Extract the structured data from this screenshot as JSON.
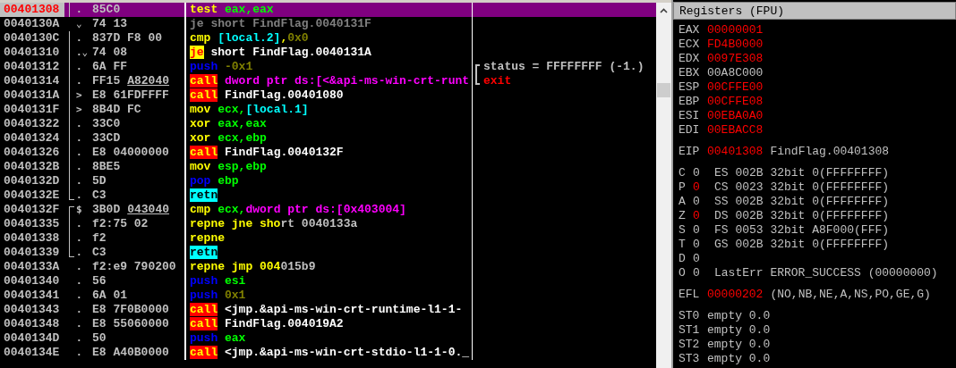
{
  "disassembly": {
    "rows": [
      {
        "address": "00401308",
        "selected": true,
        "marker": ".",
        "bracket": true,
        "bytes": "85C0",
        "tokens": [
          {
            "text": "test",
            "kind": "op"
          },
          {
            "text": " eax,eax",
            "kind": "reg"
          }
        ]
      },
      {
        "address": "0040130A",
        "selected": false,
        "marker": "⌄",
        "bracket": false,
        "bytes": "74 13",
        "tokens": [
          {
            "text": "je short FindFlag.0040131F",
            "kind": "dim"
          }
        ]
      },
      {
        "address": "0040130C",
        "selected": false,
        "marker": ".",
        "bracket": true,
        "bytes": "837D F8 00",
        "tokens": [
          {
            "text": "cmp",
            "kind": "op"
          },
          {
            "text": " [local.2]",
            "kind": "local"
          },
          {
            "text": ",",
            "kind": "op"
          },
          {
            "text": "0x0",
            "kind": "imm"
          }
        ]
      },
      {
        "address": "00401310",
        "selected": false,
        "marker": ".⌄",
        "bracket": true,
        "bytes": "74 08",
        "tokens": [
          {
            "text": "je",
            "kind": "jcc"
          },
          {
            "text": " short FindFlag.0040131A",
            "kind": "label"
          }
        ]
      },
      {
        "address": "00401312",
        "selected": false,
        "marker": ".",
        "bracket": true,
        "bytes": "6A FF",
        "tokens": [
          {
            "text": "push",
            "kind": "stack"
          },
          {
            "text": " -0x1",
            "kind": "imm"
          }
        ],
        "comment": {
          "text": "status = FFFFFFFF (-1.)",
          "kind": "arg"
        }
      },
      {
        "address": "00401314",
        "selected": false,
        "marker": ".",
        "bracket": true,
        "bytes": "FF15",
        "fixup": "A82040",
        "tokens": [
          {
            "text": "call",
            "kind": "call"
          },
          {
            "text": " dword ptr ds:[<&api-ms-win-crt-runt",
            "kind": "mem"
          }
        ],
        "comment": {
          "text": "exit",
          "kind": "api"
        }
      },
      {
        "address": "0040131A",
        "selected": false,
        "marker": ">",
        "bracket": true,
        "bytes": "E8 61FDFFFF",
        "tokens": [
          {
            "text": "call",
            "kind": "call"
          },
          {
            "text": " FindFlag.00401080",
            "kind": "label"
          }
        ]
      },
      {
        "address": "0040131F",
        "selected": false,
        "marker": ">",
        "bracket": true,
        "bytes": "8B4D FC",
        "tokens": [
          {
            "text": "mov",
            "kind": "op"
          },
          {
            "text": " ecx,",
            "kind": "reg"
          },
          {
            "text": "[local.1]",
            "kind": "local"
          }
        ]
      },
      {
        "address": "00401322",
        "selected": false,
        "marker": ".",
        "bracket": true,
        "bytes": "33C0",
        "tokens": [
          {
            "text": "xor",
            "kind": "op"
          },
          {
            "text": " eax,eax",
            "kind": "reg"
          }
        ]
      },
      {
        "address": "00401324",
        "selected": false,
        "marker": ".",
        "bracket": true,
        "bytes": "33CD",
        "tokens": [
          {
            "text": "xor",
            "kind": "op"
          },
          {
            "text": " ecx,ebp",
            "kind": "reg"
          }
        ]
      },
      {
        "address": "00401326",
        "selected": false,
        "marker": ".",
        "bracket": true,
        "bytes": "E8 04000000",
        "tokens": [
          {
            "text": "call",
            "kind": "call"
          },
          {
            "text": " FindFlag.0040132F",
            "kind": "label"
          }
        ]
      },
      {
        "address": "0040132B",
        "selected": false,
        "marker": ".",
        "bracket": true,
        "bytes": "8BE5",
        "tokens": [
          {
            "text": "mov",
            "kind": "op"
          },
          {
            "text": " esp,ebp",
            "kind": "reg"
          }
        ]
      },
      {
        "address": "0040132D",
        "selected": false,
        "marker": ".",
        "bracket": true,
        "bytes": "5D",
        "tokens": [
          {
            "text": "pop",
            "kind": "stack"
          },
          {
            "text": " ebp",
            "kind": "reg"
          }
        ]
      },
      {
        "address": "0040132E",
        "selected": false,
        "marker": ".",
        "bracket": true,
        "bracket_bottom": true,
        "bytes": "C3",
        "tokens": [
          {
            "text": "retn",
            "kind": "ret"
          }
        ]
      },
      {
        "address": "0040132F",
        "selected": false,
        "marker": "$",
        "bracket": true,
        "bracket_top": true,
        "bytes": "3B0D",
        "fixup": "043040",
        "tokens": [
          {
            "text": "cmp",
            "kind": "op"
          },
          {
            "text": " ecx,",
            "kind": "reg"
          },
          {
            "text": "dword ptr ds:[0x403004]",
            "kind": "mem"
          }
        ]
      },
      {
        "address": "00401335",
        "selected": false,
        "marker": ".",
        "bracket": true,
        "bytes": "f2:75 02",
        "tokens": [
          {
            "text": "repne jne sho",
            "kind": "op"
          },
          {
            "text": "rt 0040133a",
            "kind": "plain"
          }
        ]
      },
      {
        "address": "00401338",
        "selected": false,
        "marker": ".",
        "bracket": true,
        "bytes": "f2",
        "tokens": [
          {
            "text": "repne",
            "kind": "op"
          }
        ]
      },
      {
        "address": "00401339",
        "selected": false,
        "marker": ".",
        "bracket": true,
        "bracket_bottom": true,
        "bytes": "C3",
        "tokens": [
          {
            "text": "retn",
            "kind": "ret"
          }
        ]
      },
      {
        "address": "0040133A",
        "selected": false,
        "marker": ".",
        "bracket": false,
        "bytes": "f2:e9 790200",
        "tokens": [
          {
            "text": "repne jmp 004",
            "kind": "op"
          },
          {
            "text": "015b9",
            "kind": "plain"
          }
        ]
      },
      {
        "address": "00401340",
        "selected": false,
        "marker": ".",
        "bracket": false,
        "bytes": "56",
        "tokens": [
          {
            "text": "push",
            "kind": "stack"
          },
          {
            "text": " esi",
            "kind": "reg"
          }
        ]
      },
      {
        "address": "00401341",
        "selected": false,
        "marker": ".",
        "bracket": false,
        "bytes": "6A 01",
        "tokens": [
          {
            "text": "push",
            "kind": "stack"
          },
          {
            "text": " 0x1",
            "kind": "imm"
          }
        ]
      },
      {
        "address": "00401343",
        "selected": false,
        "marker": ".",
        "bracket": false,
        "bytes": "E8 7F0B0000",
        "tokens": [
          {
            "text": "call",
            "kind": "call"
          },
          {
            "text": " <jmp.&api-ms-win-crt-runtime-l1-1-",
            "kind": "label"
          }
        ]
      },
      {
        "address": "00401348",
        "selected": false,
        "marker": ".",
        "bracket": false,
        "bytes": "E8 55060000",
        "tokens": [
          {
            "text": "call",
            "kind": "call"
          },
          {
            "text": " FindFlag.004019A2",
            "kind": "label"
          }
        ]
      },
      {
        "address": "0040134D",
        "selected": false,
        "marker": ".",
        "bracket": false,
        "bytes": "50",
        "tokens": [
          {
            "text": "push",
            "kind": "stack"
          },
          {
            "text": " eax",
            "kind": "reg"
          }
        ]
      },
      {
        "address": "0040134E",
        "selected": false,
        "marker": ".",
        "bracket": false,
        "bytes": "E8 A40B0000",
        "tokens": [
          {
            "text": "call",
            "kind": "call"
          },
          {
            "text": " <jmp.&api-ms-win-crt-stdio-l1-1-0._",
            "kind": "label"
          }
        ]
      }
    ]
  },
  "registers_panel": {
    "title": "Registers (FPU)",
    "registers": [
      {
        "name": "EAX",
        "value": "00000001",
        "changed": true
      },
      {
        "name": "ECX",
        "value": "FD4B0000",
        "changed": true
      },
      {
        "name": "EDX",
        "value": "0097E308",
        "changed": true
      },
      {
        "name": "EBX",
        "value": "00A8C000",
        "changed": false
      },
      {
        "name": "ESP",
        "value": "00CFFE00",
        "changed": true
      },
      {
        "name": "EBP",
        "value": "00CFFE08",
        "changed": true
      },
      {
        "name": "ESI",
        "value": "00EBA0A0",
        "changed": true
      },
      {
        "name": "EDI",
        "value": "00EBACC8",
        "changed": true
      }
    ],
    "eip": {
      "name": "EIP",
      "value": "00401308",
      "changed": true,
      "info": "FindFlag.00401308"
    },
    "flags": [
      {
        "name": "C",
        "value": "0",
        "changed": false,
        "info": "ES 002B 32bit 0(FFFFFFFF)"
      },
      {
        "name": "P",
        "value": "0",
        "changed": true,
        "info": "CS 0023 32bit 0(FFFFFFFF)"
      },
      {
        "name": "A",
        "value": "0",
        "changed": false,
        "info": "SS 002B 32bit 0(FFFFFFFF)"
      },
      {
        "name": "Z",
        "value": "0",
        "changed": true,
        "info": "DS 002B 32bit 0(FFFFFFFF)"
      },
      {
        "name": "S",
        "value": "0",
        "changed": false,
        "info": "FS 0053 32bit A8F000(FFF)"
      },
      {
        "name": "T",
        "value": "0",
        "changed": false,
        "info": "GS 002B 32bit 0(FFFFFFFF)"
      },
      {
        "name": "D",
        "value": "0",
        "changed": false
      },
      {
        "name": "O",
        "value": "0",
        "changed": false,
        "info": "LastErr ERROR_SUCCESS (00000000)"
      }
    ],
    "efl": {
      "name": "EFL",
      "value": "00000202",
      "changed": true,
      "info": "(NO,NB,NE,A,NS,PO,GE,G)"
    },
    "fpu": [
      {
        "name": "ST0",
        "value": "empty 0.0"
      },
      {
        "name": "ST1",
        "value": "empty 0.0"
      },
      {
        "name": "ST2",
        "value": "empty 0.0"
      },
      {
        "name": "ST3",
        "value": "empty 0.0"
      }
    ]
  }
}
